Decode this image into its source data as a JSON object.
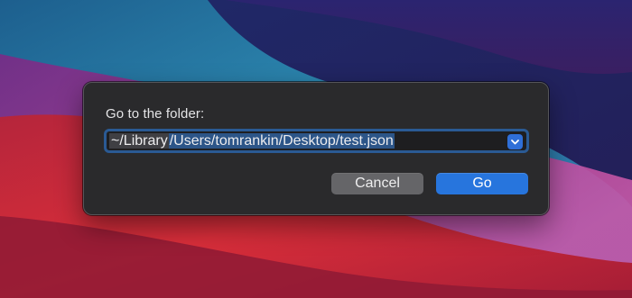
{
  "dialog": {
    "prompt": "Go to the folder:",
    "path_field": {
      "prefix": "~/Library",
      "selected": "/Users/tomrankin/Desktop/test.json",
      "dropdown_icon": "chevron-down-icon"
    },
    "buttons": {
      "cancel_label": "Cancel",
      "go_label": "Go"
    }
  },
  "colors": {
    "dialog_bg": "#2a2a2c",
    "focus_ring": "#2a5a94",
    "selection": "#2c5588",
    "accent": "#2775dd",
    "secondary_button": "#656568"
  }
}
